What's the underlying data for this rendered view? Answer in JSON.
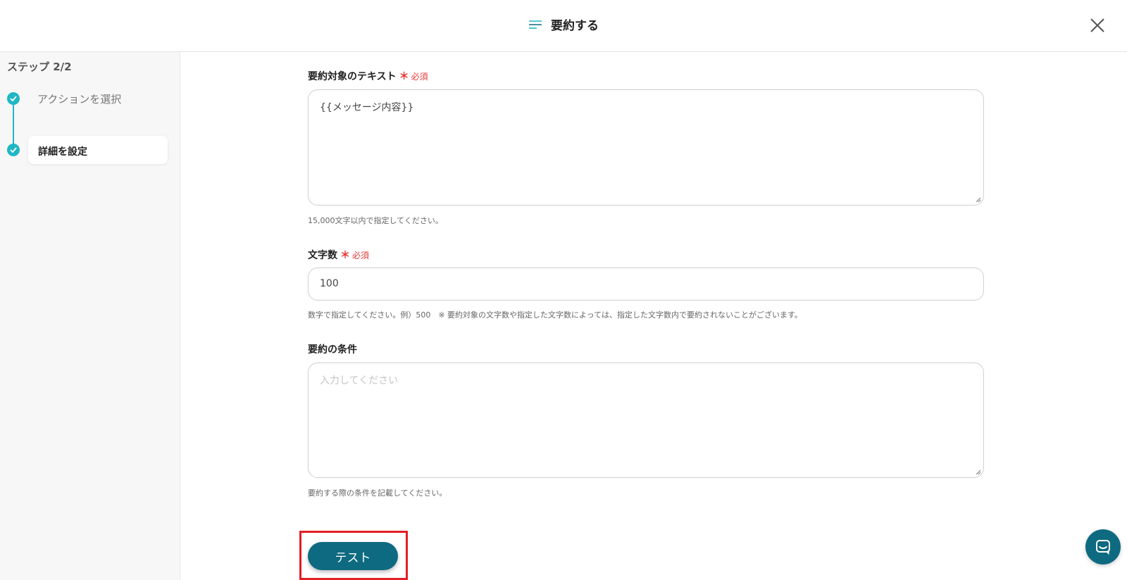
{
  "header": {
    "title": "要約する",
    "title_icon": "summary-lines-icon",
    "close_icon": "close-icon"
  },
  "sidebar": {
    "step_count": "ステップ 2/2",
    "steps": [
      {
        "label": "アクションを選択",
        "state": "done",
        "icon": "check-icon"
      },
      {
        "label": "詳細を設定",
        "state": "current",
        "icon": "check-icon"
      }
    ]
  },
  "form": {
    "text_field": {
      "label": "要約対象のテキスト",
      "asterisk": "＊",
      "required_label": "必須",
      "value": "{{メッセージ内容}}",
      "help": "15,000文字以内で指定してください。"
    },
    "char_count_field": {
      "label": "文字数",
      "asterisk": "＊",
      "required_label": "必須",
      "value": "100",
      "help": "数字で指定してください。例）500　※ 要約対象の文字数や指定した文字数によっては、指定した文字数内で要約されないことがございます。"
    },
    "conditions_field": {
      "label": "要約の条件",
      "value": "",
      "placeholder": "入力してください",
      "help": "要約する際の条件を記載してください。"
    }
  },
  "actions": {
    "test_label": "テスト"
  },
  "chat": {
    "icon": "chat-icon"
  },
  "colors": {
    "accent": "#1fb7c4",
    "primary_button": "#0e6a80",
    "required": "#e53935",
    "highlight": "#e31e24"
  }
}
